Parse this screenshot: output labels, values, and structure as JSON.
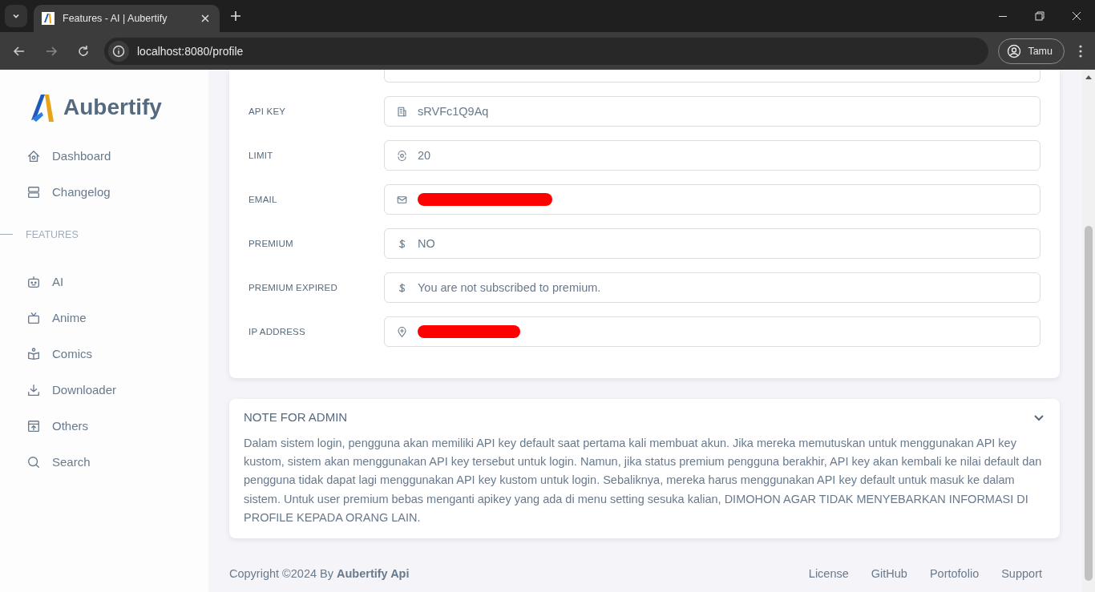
{
  "browser": {
    "tab_title": "Features - AI | Aubertify",
    "url": "localhost:8080/profile",
    "profile": "Tamu"
  },
  "sidebar": {
    "brand": "Aubertify",
    "items": [
      {
        "label": "Dashboard"
      },
      {
        "label": "Changelog"
      }
    ],
    "section": "FEATURES",
    "features": [
      {
        "label": "AI"
      },
      {
        "label": "Anime"
      },
      {
        "label": "Comics"
      },
      {
        "label": "Downloader"
      },
      {
        "label": "Others"
      },
      {
        "label": "Search"
      }
    ]
  },
  "profile": {
    "fields": [
      {
        "label": "API KEY",
        "kind": "text",
        "value": "sRVFc1Q9Aq"
      },
      {
        "label": "LIMIT",
        "kind": "text",
        "value": "20"
      },
      {
        "label": "EMAIL",
        "kind": "redacted"
      },
      {
        "label": "PREMIUM",
        "kind": "text",
        "value": "NO"
      },
      {
        "label": "PREMIUM EXPIRED",
        "kind": "text",
        "value": "You are not subscribed to premium."
      },
      {
        "label": "IP ADDRESS",
        "kind": "redacted"
      }
    ]
  },
  "note": {
    "title": "NOTE FOR ADMIN",
    "expanded": true,
    "text": "Dalam sistem login, pengguna akan memiliki API key default saat pertama kali membuat akun. Jika mereka memutuskan untuk menggunakan API key kustom, sistem akan menggunakan API key tersebut untuk login. Namun, jika status premium pengguna berakhir, API key akan kembali ke nilai default dan pengguna tidak dapat lagi menggunakan API key kustom untuk login. Sebaliknya, mereka harus menggunakan API key default untuk masuk ke dalam sistem. Untuk user premium bebas menganti apikey yang ada di menu setting sesuka kalian, DIMOHON AGAR TIDAK MENYEBARKAN INFORMASI DI PROFILE KEPADA ORANG LAIN."
  },
  "footer": {
    "copyright": "Copyright ©2024 By **Aubertify Api**",
    "links": [
      "License",
      "GitHub",
      "Portofolio",
      "Support"
    ]
  }
}
